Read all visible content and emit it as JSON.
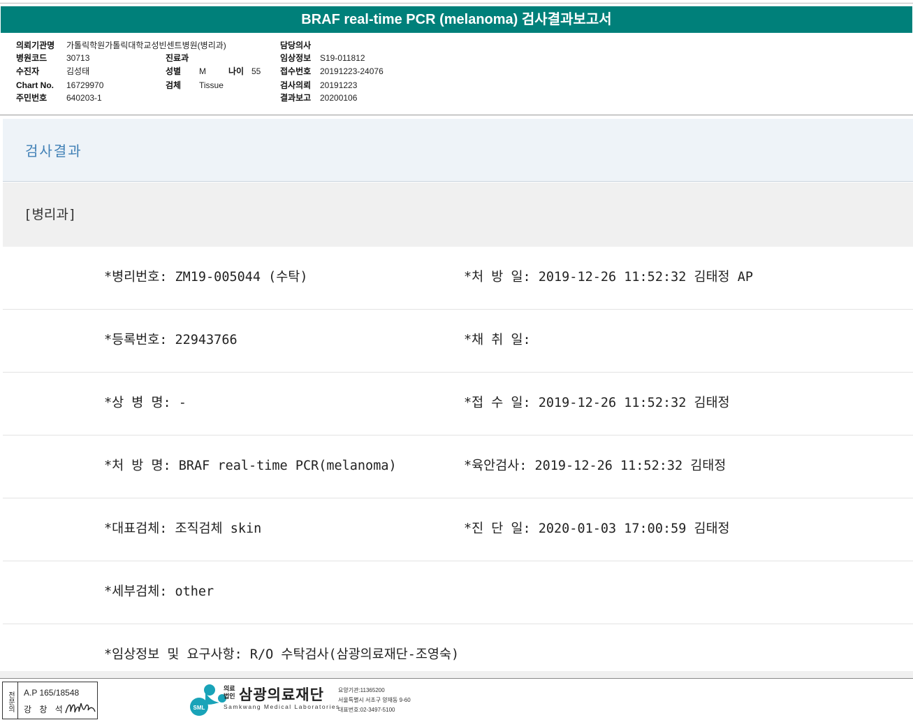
{
  "report": {
    "title": "BRAF real-time PCR (melanoma) 검사결과보고서"
  },
  "patient_info": {
    "institution_label": "의뢰기관명",
    "institution_value": "가톨릭학원가톨릭대학교성빈센트병원(병리과)",
    "attending_label": "담당의사",
    "hospital_code_label": "병원코드",
    "hospital_code_value": "30713",
    "department_label": "진료과",
    "clinical_info_label": "임상정보",
    "clinical_info_value": "S19-011812",
    "patient_label": "수진자",
    "patient_value": "김성태",
    "sex_label": "성별",
    "sex_value": "M",
    "age_label": "나이",
    "age_value": "55",
    "accession_label": "접수번호",
    "accession_value": "20191223-24076",
    "chart_label": "Chart No.",
    "chart_value": "16729970",
    "specimen_label": "검체",
    "specimen_value": "Tissue",
    "request_label": "검사의뢰",
    "request_value": "20191223",
    "rrn_label": "주민번호",
    "rrn_value": "640203-1",
    "report_label": "결과보고",
    "report_value": "20200106"
  },
  "result_section": {
    "heading": "검사결과",
    "department": "[병리과]"
  },
  "result_rows": [
    {
      "left": "*병리번호: ZM19-005044 (수탁)",
      "right": "*처 방 일: 2019-12-26 11:52:32  김태정 AP"
    },
    {
      "left": "*등록번호: 22943766",
      "right": "*채 취 일:"
    },
    {
      "left": "*상 병 명: -",
      "right": "*접 수 일: 2019-12-26 11:52:32  김태정"
    },
    {
      "left": "*처 방 명: BRAF real-time PCR(melanoma)",
      "right": "*육안검사: 2019-12-26 11:52:32  김태정"
    },
    {
      "left": "*대표검체: 조직검체 skin",
      "right": "*진 단 일: 2020-01-03 17:00:59  김태정"
    },
    {
      "left": "*세부검체: other",
      "right": ""
    },
    {
      "left": "*임상정보 및 요구사항: R/O 수탁검사(삼광의료재단-조영숙)",
      "right": ""
    }
  ],
  "footer": {
    "stamp_vertical": "전문의",
    "stamp_ap": "A.P 165/18548",
    "stamp_name": "강 창 석",
    "corp_small": "의료법인",
    "corp_name": "삼광의료재단",
    "corp_english": "Samkwang Medical Laboratories",
    "corp_badge": "SML",
    "addr_line1": "요양기관:11365200",
    "addr_line2": "서울특별시 서초구 양재동 9-60",
    "addr_line3": "대표번호:02-3497-5100"
  }
}
